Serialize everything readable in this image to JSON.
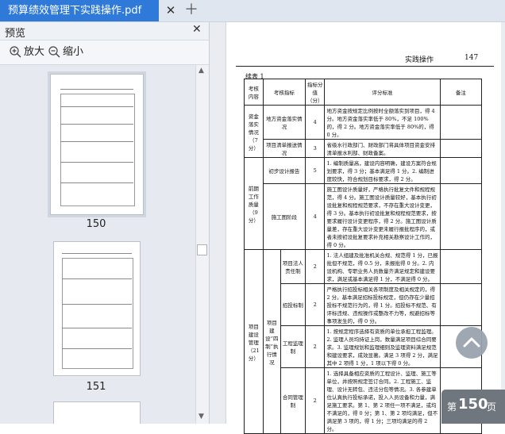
{
  "tab": {
    "title": "预算绩效管理下实践操作.pdf"
  },
  "sidebar": {
    "title": "预览",
    "zoom_in": "放大",
    "zoom_out": "缩小",
    "thumbnails": [
      {
        "label": "150"
      },
      {
        "label": "151"
      }
    ]
  },
  "document": {
    "header_text": "实践操作",
    "header_page": "147",
    "continued": "续表 1",
    "columns": [
      "考核内容",
      "考核指标",
      "指标分值（分）",
      "评分标准",
      "备注"
    ],
    "rows": [
      {
        "content": "资金落实情况（7分）",
        "indicator": "地方资金落实情况",
        "score": "4",
        "criteria": "地方资金按规定比例按时全额落实到项目，得 4 分。地方资金落实率低于 80%，不足 100%的，得 2 分。地方资金落实率低于 80%的，得 0 分。"
      },
      {
        "content": "",
        "indicator": "项目清单报送情况",
        "score": "3",
        "criteria": "省级水行政部门、财政部门将具体项目资金安排清单报水利部、财政备案。"
      },
      {
        "content": "前期工作质量（9分）",
        "indicator": "初步设计报告",
        "score": "5",
        "criteria": "1. 编制质量高，建设内容明确，建设方案符合规划要求，得 3 分；基本满足得 1 分。2. 编制进度较快，符合规划目标要求，得 2 分。"
      },
      {
        "content": "",
        "indicator": "施工图阶段",
        "score": "4",
        "criteria": "施工图设计质量好，严格执行批复文件和规程规范，得 4 分。施工图设计质量较好，基本执行初设批复和规程规范要求，不存在重大设计变更，得 3 分。基本执行初设批复和规程规范要求，按要求履行设计变更程序，得 2 分。施工图设计质量差，存在重大设计变更未履行报批程序的，或者未按初设批复要求补充相关勘察设计工作的，得 0 分。"
      },
      {
        "content": "项目建设管理（21分）",
        "indicator": "项目建设“四制”执行情况",
        "sub": "项目法人责任制",
        "score": "2",
        "criteria": "1. 法人组建及批准机关合规、规范得 1 分，已报批但不规范，得 0.5 分，未报批得 0 分。2. 内设机构、专职业务人员数量齐满足规定和建设要求，满足或基本满足得 1 分，不满足得 0 分。"
      },
      {
        "content": "",
        "indicator": "",
        "sub": "招投标制",
        "score": "2",
        "criteria": "严格执行招投标相关各项制度及相关规定的，得 2 分。基本满足招标投标规定，但仍存在少量招投标不规范行为的，得 1 分。招投标不规范、有评标违规、违规操作或整改不力等，规避招标等事项发生的，得 0 分。"
      },
      {
        "content": "",
        "indicator": "",
        "sub": "工程监理制",
        "score": "2",
        "criteria": "1. 按规定程序选择有资质的单位承担工程监理。2. 监理人员均持证上岗，数量满足项目综合同要求。3. 监理规划和监理细则及监理资料满足规范和建设要求，成效显著。满足 3 项得 2 分，满足其中 2 项得 1 分，1 项以下得 0 分。"
      },
      {
        "content": "",
        "indicator": "",
        "sub": "合同管理制",
        "score": "2",
        "criteria": "1. 选择具备相应资质的工程设计、监理、施工等单位，并按照规定签订合同。2. 工程施工、监理、设计无转包、违法分包等情况。3. 各参建单位认真执行投标承诺，投入人员设备和力量，满足施工要求。第 1、第 2 项任一项不满足，或均不满足的，得 0 分；第 1、第 2 项均满足，但不满足第 3 项的，得 1 分；三项均满足的得 2 分。"
      }
    ]
  },
  "page_badge": {
    "prefix": "第",
    "number": "150",
    "suffix": "页"
  }
}
